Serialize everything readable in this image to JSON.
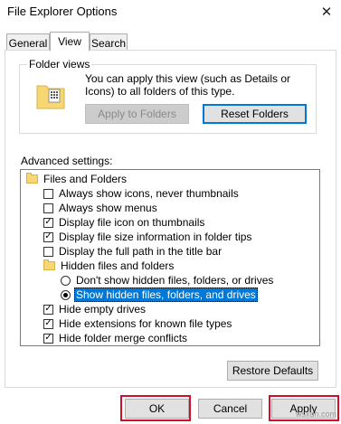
{
  "window": {
    "title": "File Explorer Options",
    "close_glyph": "✕"
  },
  "tabs": [
    {
      "label": "General"
    },
    {
      "label": "View",
      "active": true
    },
    {
      "label": "Search"
    }
  ],
  "folder_views": {
    "group_label": "Folder views",
    "description": "You can apply this view (such as Details or Icons) to all folders of this type.",
    "apply_button": "Apply to Folders",
    "reset_button": "Reset Folders"
  },
  "advanced": {
    "label": "Advanced settings:",
    "items": [
      {
        "type": "folder",
        "label": "Files and Folders"
      },
      {
        "type": "checkbox",
        "label": "Always show icons, never thumbnails",
        "checked": false
      },
      {
        "type": "checkbox",
        "label": "Always show menus",
        "checked": false
      },
      {
        "type": "checkbox",
        "label": "Display file icon on thumbnails",
        "checked": true
      },
      {
        "type": "checkbox",
        "label": "Display file size information in folder tips",
        "checked": true
      },
      {
        "type": "checkbox",
        "label": "Display the full path in the title bar",
        "checked": false
      },
      {
        "type": "folder",
        "label": "Hidden files and folders"
      },
      {
        "type": "radio",
        "label": "Don't show hidden files, folders, or drives",
        "checked": false
      },
      {
        "type": "radio",
        "label": "Show hidden files, folders, and drives",
        "checked": true,
        "selected": true
      },
      {
        "type": "checkbox",
        "label": "Hide empty drives",
        "checked": true
      },
      {
        "type": "checkbox",
        "label": "Hide extensions for known file types",
        "checked": true
      },
      {
        "type": "checkbox",
        "label": "Hide folder merge conflicts",
        "checked": true
      }
    ],
    "restore_button": "Restore Defaults"
  },
  "footer": {
    "ok": "OK",
    "cancel": "Cancel",
    "apply": "Apply"
  },
  "watermark": "wsxdn.com",
  "colors": {
    "highlight": "#0078d7",
    "annotation_red": "#d20f2a",
    "folder_yellow": "#f7d774"
  },
  "icons": {
    "close": "close-icon",
    "folder": "folder-icon",
    "folder_views": "folder-views-icon"
  }
}
